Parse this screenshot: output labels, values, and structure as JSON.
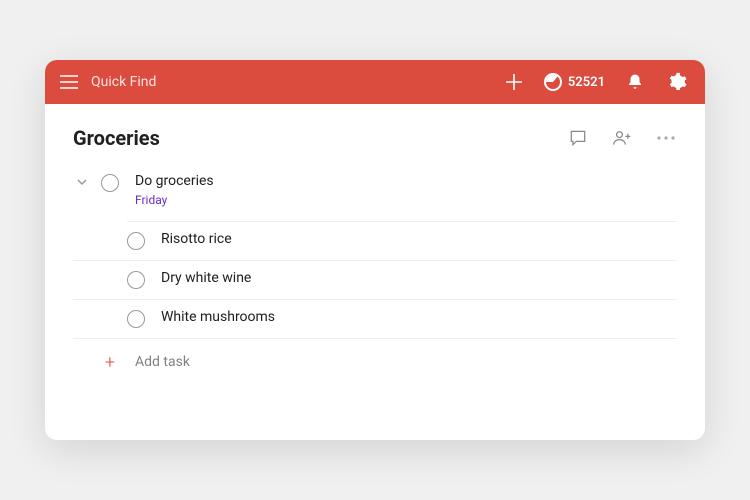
{
  "topbar": {
    "search_placeholder": "Quick Find",
    "karma_count": "52521"
  },
  "list": {
    "title": "Groceries"
  },
  "tasks": {
    "parent": {
      "title": "Do groceries",
      "due": "Friday"
    },
    "subtasks": [
      {
        "title": "Risotto rice"
      },
      {
        "title": "Dry white wine"
      },
      {
        "title": "White mushrooms"
      }
    ]
  },
  "add_task": {
    "label": "Add task"
  }
}
